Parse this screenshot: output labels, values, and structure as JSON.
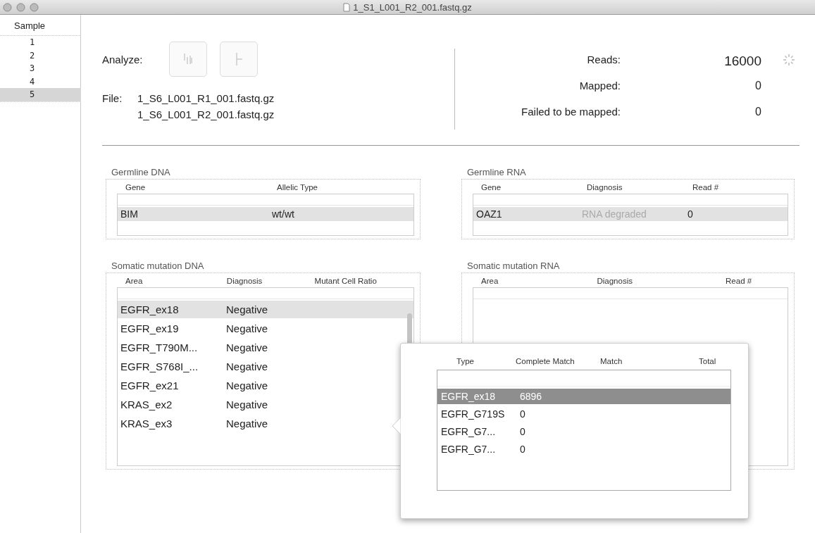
{
  "window": {
    "title": "1_S1_L001_R2_001.fastq.gz"
  },
  "sidebar": {
    "header": "Sample",
    "items": [
      {
        "label": "1",
        "selected": false
      },
      {
        "label": "2",
        "selected": false
      },
      {
        "label": "3",
        "selected": false
      },
      {
        "label": "4",
        "selected": false
      },
      {
        "label": "5",
        "selected": true
      }
    ]
  },
  "analyze": {
    "label": "Analyze:",
    "buttons": [
      {
        "kind": "bars"
      },
      {
        "kind": "marker"
      }
    ]
  },
  "file": {
    "label": "File:",
    "names": [
      "1_S6_L001_R1_001.fastq.gz",
      "1_S6_L001_R2_001.fastq.gz"
    ]
  },
  "stats": [
    {
      "label": "Reads:",
      "value": "16000",
      "busy": true
    },
    {
      "label": "Mapped:",
      "value": "0",
      "busy": false
    },
    {
      "label": "Failed to be mapped:",
      "value": "0",
      "busy": false
    }
  ],
  "panels": [
    {
      "title": "Germline DNA",
      "columns": [
        "Gene",
        "Allelic Type"
      ],
      "rows": [
        {
          "selected": true,
          "cells": [
            {
              "text": "BIM",
              "dimmed": false
            },
            {
              "text": "wt/wt",
              "dimmed": false
            }
          ]
        }
      ]
    },
    {
      "title": "Germline RNA",
      "columns": [
        "Gene",
        "Diagnosis",
        "Read #"
      ],
      "rows": [
        {
          "selected": true,
          "cells": [
            {
              "text": "OAZ1",
              "dimmed": false
            },
            {
              "text": "RNA degraded",
              "dimmed": true
            },
            {
              "text": "0",
              "dimmed": false
            }
          ]
        }
      ]
    },
    {
      "title": "Somatic mutation DNA",
      "columns": [
        "Area",
        "Diagnosis",
        "Mutant Cell Ratio"
      ],
      "rows": [
        {
          "selected": true,
          "cells": [
            {
              "text": "EGFR_ex18",
              "dimmed": false
            },
            {
              "text": "Negative",
              "dimmed": false
            }
          ]
        },
        {
          "selected": false,
          "cells": [
            {
              "text": "EGFR_ex19",
              "dimmed": false
            },
            {
              "text": "Negative",
              "dimmed": false
            }
          ]
        },
        {
          "selected": false,
          "cells": [
            {
              "text": "EGFR_T790M...",
              "dimmed": false
            },
            {
              "text": "Negative",
              "dimmed": false
            }
          ]
        },
        {
          "selected": false,
          "cells": [
            {
              "text": "EGFR_S768I_...",
              "dimmed": false
            },
            {
              "text": "Negative",
              "dimmed": false
            }
          ]
        },
        {
          "selected": false,
          "cells": [
            {
              "text": "EGFR_ex21",
              "dimmed": false
            },
            {
              "text": "Negative",
              "dimmed": false
            }
          ]
        },
        {
          "selected": false,
          "cells": [
            {
              "text": "KRAS_ex2",
              "dimmed": false
            },
            {
              "text": "Negative",
              "dimmed": false
            }
          ]
        },
        {
          "selected": false,
          "cells": [
            {
              "text": "KRAS_ex3",
              "dimmed": false
            },
            {
              "text": "Negative",
              "dimmed": false
            }
          ]
        }
      ]
    },
    {
      "title": "Somatic mutation RNA",
      "columns": [
        "Area",
        "Diagnosis",
        "Read #"
      ]
    }
  ],
  "popover": {
    "columns": [
      "Type",
      "Complete Match",
      "Match",
      "Total"
    ],
    "rows": [
      {
        "selected": true,
        "cells": [
          "EGFR_ex18",
          "6896"
        ]
      },
      {
        "selected": false,
        "cells": [
          "EGFR_G719S",
          "0"
        ]
      },
      {
        "selected": false,
        "cells": [
          "EGFR_G7...",
          "0"
        ]
      },
      {
        "selected": false,
        "cells": [
          "EGFR_G7...",
          "0"
        ]
      }
    ]
  }
}
